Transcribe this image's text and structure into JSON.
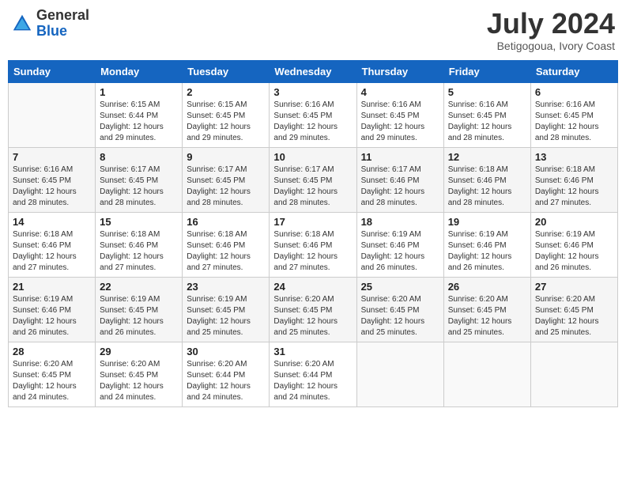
{
  "header": {
    "logo_general": "General",
    "logo_blue": "Blue",
    "month_title": "July 2024",
    "subtitle": "Betigogoua, Ivory Coast"
  },
  "days_of_week": [
    "Sunday",
    "Monday",
    "Tuesday",
    "Wednesday",
    "Thursday",
    "Friday",
    "Saturday"
  ],
  "weeks": [
    [
      {
        "day": "",
        "sunrise": "",
        "sunset": "",
        "daylight": ""
      },
      {
        "day": "1",
        "sunrise": "Sunrise: 6:15 AM",
        "sunset": "Sunset: 6:44 PM",
        "daylight": "Daylight: 12 hours and 29 minutes."
      },
      {
        "day": "2",
        "sunrise": "Sunrise: 6:15 AM",
        "sunset": "Sunset: 6:45 PM",
        "daylight": "Daylight: 12 hours and 29 minutes."
      },
      {
        "day": "3",
        "sunrise": "Sunrise: 6:16 AM",
        "sunset": "Sunset: 6:45 PM",
        "daylight": "Daylight: 12 hours and 29 minutes."
      },
      {
        "day": "4",
        "sunrise": "Sunrise: 6:16 AM",
        "sunset": "Sunset: 6:45 PM",
        "daylight": "Daylight: 12 hours and 29 minutes."
      },
      {
        "day": "5",
        "sunrise": "Sunrise: 6:16 AM",
        "sunset": "Sunset: 6:45 PM",
        "daylight": "Daylight: 12 hours and 28 minutes."
      },
      {
        "day": "6",
        "sunrise": "Sunrise: 6:16 AM",
        "sunset": "Sunset: 6:45 PM",
        "daylight": "Daylight: 12 hours and 28 minutes."
      }
    ],
    [
      {
        "day": "7",
        "sunrise": "Sunrise: 6:16 AM",
        "sunset": "Sunset: 6:45 PM",
        "daylight": "Daylight: 12 hours and 28 minutes."
      },
      {
        "day": "8",
        "sunrise": "Sunrise: 6:17 AM",
        "sunset": "Sunset: 6:45 PM",
        "daylight": "Daylight: 12 hours and 28 minutes."
      },
      {
        "day": "9",
        "sunrise": "Sunrise: 6:17 AM",
        "sunset": "Sunset: 6:45 PM",
        "daylight": "Daylight: 12 hours and 28 minutes."
      },
      {
        "day": "10",
        "sunrise": "Sunrise: 6:17 AM",
        "sunset": "Sunset: 6:45 PM",
        "daylight": "Daylight: 12 hours and 28 minutes."
      },
      {
        "day": "11",
        "sunrise": "Sunrise: 6:17 AM",
        "sunset": "Sunset: 6:46 PM",
        "daylight": "Daylight: 12 hours and 28 minutes."
      },
      {
        "day": "12",
        "sunrise": "Sunrise: 6:18 AM",
        "sunset": "Sunset: 6:46 PM",
        "daylight": "Daylight: 12 hours and 28 minutes."
      },
      {
        "day": "13",
        "sunrise": "Sunrise: 6:18 AM",
        "sunset": "Sunset: 6:46 PM",
        "daylight": "Daylight: 12 hours and 27 minutes."
      }
    ],
    [
      {
        "day": "14",
        "sunrise": "Sunrise: 6:18 AM",
        "sunset": "Sunset: 6:46 PM",
        "daylight": "Daylight: 12 hours and 27 minutes."
      },
      {
        "day": "15",
        "sunrise": "Sunrise: 6:18 AM",
        "sunset": "Sunset: 6:46 PM",
        "daylight": "Daylight: 12 hours and 27 minutes."
      },
      {
        "day": "16",
        "sunrise": "Sunrise: 6:18 AM",
        "sunset": "Sunset: 6:46 PM",
        "daylight": "Daylight: 12 hours and 27 minutes."
      },
      {
        "day": "17",
        "sunrise": "Sunrise: 6:18 AM",
        "sunset": "Sunset: 6:46 PM",
        "daylight": "Daylight: 12 hours and 27 minutes."
      },
      {
        "day": "18",
        "sunrise": "Sunrise: 6:19 AM",
        "sunset": "Sunset: 6:46 PM",
        "daylight": "Daylight: 12 hours and 26 minutes."
      },
      {
        "day": "19",
        "sunrise": "Sunrise: 6:19 AM",
        "sunset": "Sunset: 6:46 PM",
        "daylight": "Daylight: 12 hours and 26 minutes."
      },
      {
        "day": "20",
        "sunrise": "Sunrise: 6:19 AM",
        "sunset": "Sunset: 6:46 PM",
        "daylight": "Daylight: 12 hours and 26 minutes."
      }
    ],
    [
      {
        "day": "21",
        "sunrise": "Sunrise: 6:19 AM",
        "sunset": "Sunset: 6:46 PM",
        "daylight": "Daylight: 12 hours and 26 minutes."
      },
      {
        "day": "22",
        "sunrise": "Sunrise: 6:19 AM",
        "sunset": "Sunset: 6:45 PM",
        "daylight": "Daylight: 12 hours and 26 minutes."
      },
      {
        "day": "23",
        "sunrise": "Sunrise: 6:19 AM",
        "sunset": "Sunset: 6:45 PM",
        "daylight": "Daylight: 12 hours and 25 minutes."
      },
      {
        "day": "24",
        "sunrise": "Sunrise: 6:20 AM",
        "sunset": "Sunset: 6:45 PM",
        "daylight": "Daylight: 12 hours and 25 minutes."
      },
      {
        "day": "25",
        "sunrise": "Sunrise: 6:20 AM",
        "sunset": "Sunset: 6:45 PM",
        "daylight": "Daylight: 12 hours and 25 minutes."
      },
      {
        "day": "26",
        "sunrise": "Sunrise: 6:20 AM",
        "sunset": "Sunset: 6:45 PM",
        "daylight": "Daylight: 12 hours and 25 minutes."
      },
      {
        "day": "27",
        "sunrise": "Sunrise: 6:20 AM",
        "sunset": "Sunset: 6:45 PM",
        "daylight": "Daylight: 12 hours and 25 minutes."
      }
    ],
    [
      {
        "day": "28",
        "sunrise": "Sunrise: 6:20 AM",
        "sunset": "Sunset: 6:45 PM",
        "daylight": "Daylight: 12 hours and 24 minutes."
      },
      {
        "day": "29",
        "sunrise": "Sunrise: 6:20 AM",
        "sunset": "Sunset: 6:45 PM",
        "daylight": "Daylight: 12 hours and 24 minutes."
      },
      {
        "day": "30",
        "sunrise": "Sunrise: 6:20 AM",
        "sunset": "Sunset: 6:44 PM",
        "daylight": "Daylight: 12 hours and 24 minutes."
      },
      {
        "day": "31",
        "sunrise": "Sunrise: 6:20 AM",
        "sunset": "Sunset: 6:44 PM",
        "daylight": "Daylight: 12 hours and 24 minutes."
      },
      {
        "day": "",
        "sunrise": "",
        "sunset": "",
        "daylight": ""
      },
      {
        "day": "",
        "sunrise": "",
        "sunset": "",
        "daylight": ""
      },
      {
        "day": "",
        "sunrise": "",
        "sunset": "",
        "daylight": ""
      }
    ]
  ]
}
